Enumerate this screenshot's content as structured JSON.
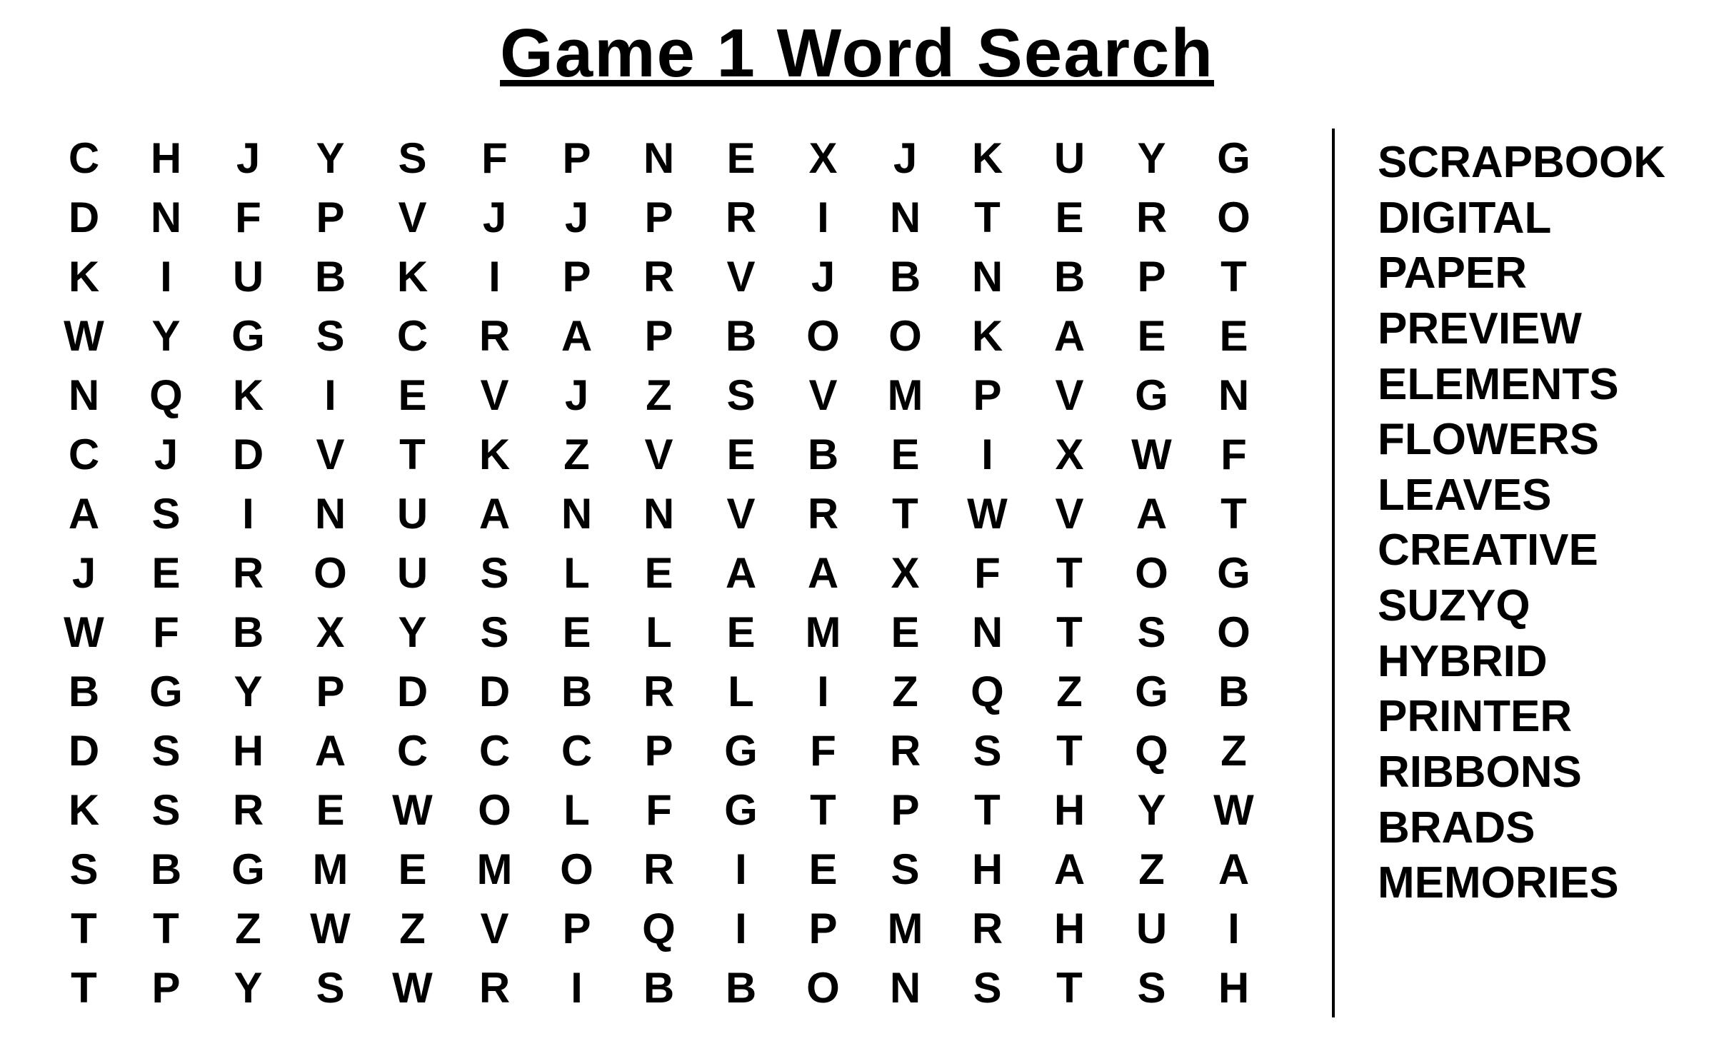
{
  "title": "Game 1 Word Search",
  "grid": [
    [
      "C",
      "H",
      "J",
      "Y",
      "S",
      "F",
      "P",
      "N",
      "E",
      "X",
      "J",
      "K",
      "U",
      "Y",
      "G"
    ],
    [
      "D",
      "N",
      "F",
      "P",
      "V",
      "J",
      "J",
      "P",
      "R",
      "I",
      "N",
      "T",
      "E",
      "R",
      "O"
    ],
    [
      "K",
      "I",
      "U",
      "B",
      "K",
      "I",
      "P",
      "R",
      "V",
      "J",
      "B",
      "N",
      "B",
      "P",
      "T"
    ],
    [
      "W",
      "Y",
      "G",
      "S",
      "C",
      "R",
      "A",
      "P",
      "B",
      "O",
      "O",
      "K",
      "A",
      "E",
      "E"
    ],
    [
      "N",
      "Q",
      "K",
      "I",
      "E",
      "V",
      "J",
      "Z",
      "S",
      "V",
      "M",
      "P",
      "V",
      "G",
      "N"
    ],
    [
      "C",
      "J",
      "D",
      "V",
      "T",
      "K",
      "Z",
      "V",
      "E",
      "B",
      "E",
      "I",
      "X",
      "W",
      "F"
    ],
    [
      "A",
      "S",
      "I",
      "N",
      "U",
      "A",
      "N",
      "N",
      "V",
      "R",
      "T",
      "W",
      "V",
      "A",
      "T"
    ],
    [
      "J",
      "E",
      "R",
      "O",
      "U",
      "S",
      "L",
      "E",
      "A",
      "A",
      "X",
      "F",
      "T",
      "O",
      "G"
    ],
    [
      "W",
      "F",
      "B",
      "X",
      "Y",
      "S",
      "E",
      "L",
      "E",
      "M",
      "E",
      "N",
      "T",
      "S",
      "O"
    ],
    [
      "B",
      "G",
      "Y",
      "P",
      "D",
      "D",
      "B",
      "R",
      "L",
      "I",
      "Z",
      "Q",
      "Z",
      "G",
      "B"
    ],
    [
      "D",
      "S",
      "H",
      "A",
      "C",
      "C",
      "C",
      "P",
      "G",
      "F",
      "R",
      "S",
      "T",
      "Q",
      "Z"
    ],
    [
      "K",
      "S",
      "R",
      "E",
      "W",
      "O",
      "L",
      "F",
      "G",
      "T",
      "P",
      "T",
      "H",
      "Y",
      "W"
    ],
    [
      "S",
      "B",
      "G",
      "M",
      "E",
      "M",
      "O",
      "R",
      "I",
      "E",
      "S",
      "H",
      "A",
      "Z",
      "A"
    ],
    [
      "T",
      "T",
      "Z",
      "W",
      "Z",
      "V",
      "P",
      "Q",
      "I",
      "P",
      "M",
      "R",
      "H",
      "U",
      "I"
    ],
    [
      "T",
      "P",
      "Y",
      "S",
      "W",
      "R",
      "I",
      "B",
      "B",
      "O",
      "N",
      "S",
      "T",
      "S",
      "H"
    ]
  ],
  "words": [
    "SCRAPBOOK",
    "DIGITAL",
    "PAPER",
    "PREVIEW",
    "ELEMENTS",
    "FLOWERS",
    "LEAVES",
    "CREATIVE",
    "SUZYQ",
    "HYBRID",
    "PRINTER",
    "RIBBONS",
    "BRADS",
    "MEMORIES"
  ]
}
